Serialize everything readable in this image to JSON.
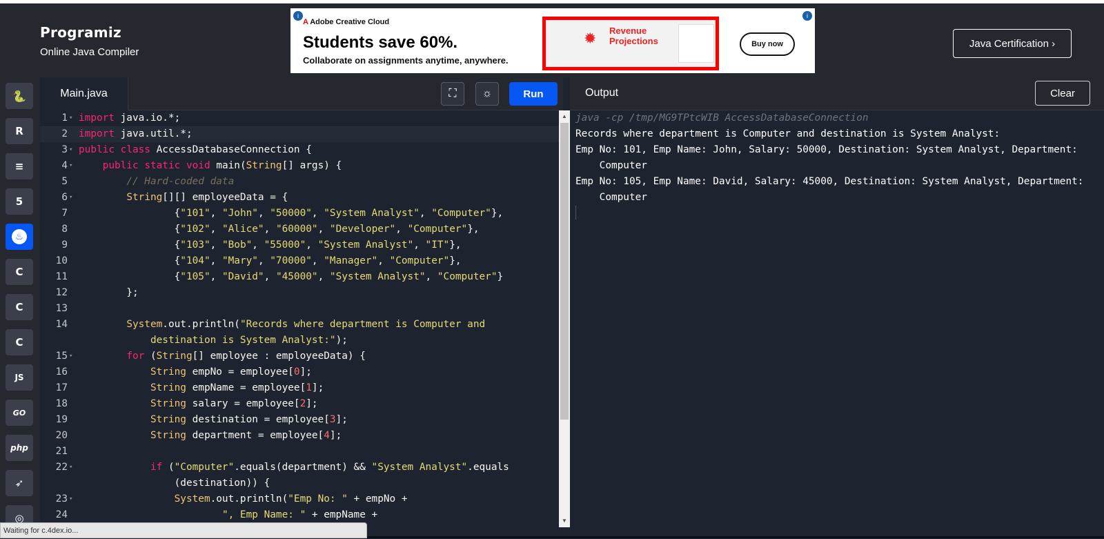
{
  "header": {
    "logo": "Programiz",
    "subtitle": "Online Java Compiler",
    "cert_button": "Java Certification ›"
  },
  "ad": {
    "brand": "Adobe Creative Cloud",
    "headline": "Students save 60%.",
    "tagline": "Collaborate on assignments anytime, anywhere.",
    "image_title": "Revenue Projections",
    "cta": "Buy now"
  },
  "sidebar": {
    "items": [
      {
        "name": "python",
        "label": "🐍"
      },
      {
        "name": "r",
        "label": "R"
      },
      {
        "name": "sql",
        "label": "≡"
      },
      {
        "name": "html",
        "label": "5"
      },
      {
        "name": "java",
        "label": "♨"
      },
      {
        "name": "c",
        "label": "C"
      },
      {
        "name": "cpp",
        "label": "C"
      },
      {
        "name": "csharp",
        "label": "C"
      },
      {
        "name": "js",
        "label": "JS"
      },
      {
        "name": "go",
        "label": "GO"
      },
      {
        "name": "php",
        "label": "php"
      },
      {
        "name": "swift",
        "label": "➶"
      },
      {
        "name": "more",
        "label": "◎"
      }
    ]
  },
  "editor": {
    "tab": "Main.java",
    "run_label": "Run"
  },
  "output": {
    "title": "Output",
    "clear_label": "Clear",
    "lines": [
      "java -cp /tmp/MG9TPtcWIB AccessDatabaseConnection",
      "Records where department is Computer and destination is System Analyst:",
      "Emp No: 101, Emp Name: John, Salary: 50000, Destination: System Analyst, Department:",
      "    Computer",
      "Emp No: 105, Emp Name: David, Salary: 45000, Destination: System Analyst, Department:",
      "    Computer"
    ]
  },
  "status": "Waiting for c.4dex.io...",
  "code": {
    "line_numbers": [
      "1",
      "2",
      "3",
      "4",
      "5",
      "6",
      "7",
      "8",
      "9",
      "10",
      "11",
      "12",
      "13",
      "14",
      "",
      "15",
      "16",
      "17",
      "18",
      "19",
      "20",
      "21",
      "22",
      "",
      "23",
      "24"
    ]
  }
}
